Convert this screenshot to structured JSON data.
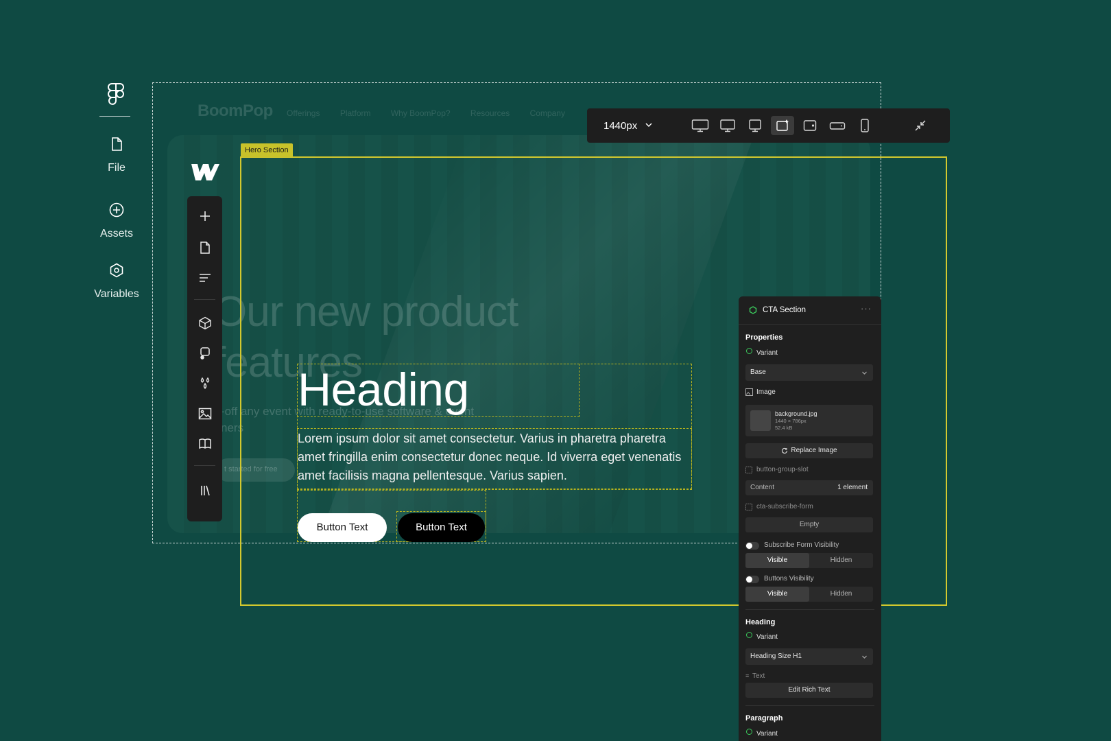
{
  "figma_rail": {
    "items": [
      {
        "label": "File",
        "icon": "file-icon"
      },
      {
        "label": "Assets",
        "icon": "plus-circle-icon"
      },
      {
        "label": "Variables",
        "icon": "hexagon-icon"
      }
    ]
  },
  "site": {
    "logo": "BoomPop",
    "nav": [
      "Offerings",
      "Platform",
      "Why BoomPop?",
      "Resources",
      "Company"
    ],
    "ghost_title_line1": "Our new  product",
    "ghost_title_line2": "features",
    "ghost_subtitle_line1": "-off any event with ready-to-use software & event",
    "ghost_subtitle_line2": "ners",
    "ghost_button": "t started for free"
  },
  "hero": {
    "tag": "Hero Section",
    "heading": "Heading",
    "paragraph": "Lorem ipsum dolor sit amet consectetur. Varius in pharetra pharetra amet fringilla enim consectetur donec neque. Id viverra eget venenatis amet facilisis magna pellentesque. Varius sapien.",
    "button_primary": "Button Text",
    "button_secondary": "Button Text"
  },
  "breakpoint_bar": {
    "width_label": "1440px",
    "icons": [
      "desktop-xl-icon",
      "desktop-large-icon",
      "desktop-icon",
      "desktop-base-icon",
      "tablet-icon",
      "mobile-landscape-icon",
      "mobile-portrait-icon"
    ],
    "active_icon": "desktop-base-icon"
  },
  "panel": {
    "title": "CTA Section",
    "more": "···",
    "properties_heading": "Properties",
    "variant_label": "Variant",
    "variant_value": "Base",
    "image_label": "Image",
    "image_filename": "background.jpg",
    "image_dims": "1440 × 786px",
    "image_size": "52.4 kB",
    "replace_image": "Replace Image",
    "slot1_label": "button-group-slot",
    "content_label": "Content",
    "content_value": "1 element",
    "slot2_label": "cta-subscribe-form",
    "empty_label": "Empty",
    "subscribe_visibility_label": "Subscribe Form Visibility",
    "visible": "Visible",
    "hidden": "Hidden",
    "buttons_visibility_label": "Buttons Visibility",
    "heading_section": "Heading",
    "heading_variant_label": "Variant",
    "heading_variant_value": "Heading Size H1",
    "text_label": "Text",
    "edit_rich_text": "Edit Rich Text",
    "paragraph_section": "Paragraph",
    "paragraph_variant_label": "Variant"
  }
}
